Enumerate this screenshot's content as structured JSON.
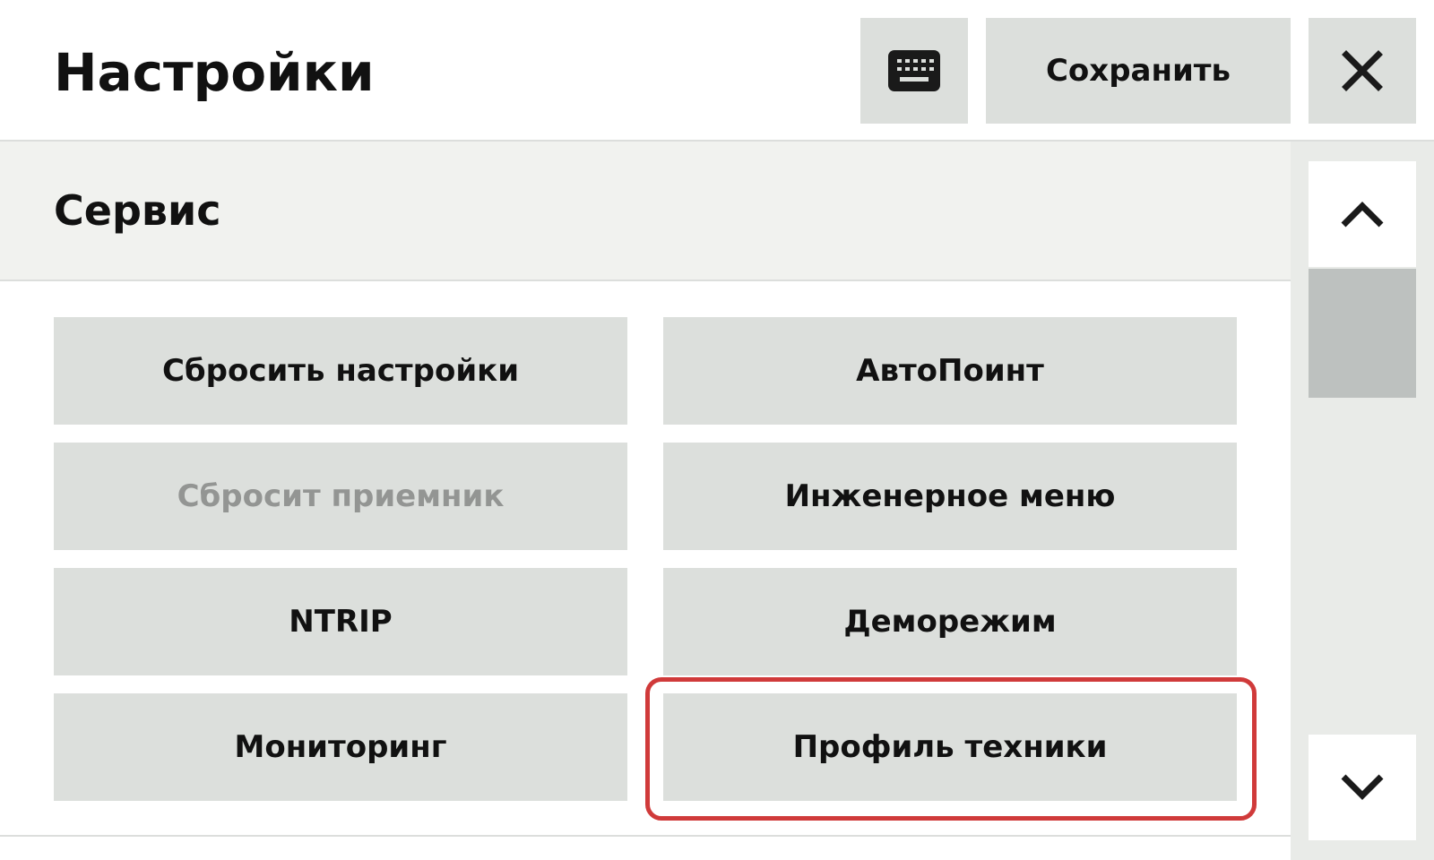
{
  "header": {
    "title": "Настройки",
    "save_label": "Сохранить"
  },
  "section": {
    "title": "Сервис"
  },
  "buttons": {
    "reset_settings": "Сбросить настройки",
    "autopoint": "АвтоПоинт",
    "reset_receiver": "Сбросит приемник",
    "engineering_menu": "Инженерное меню",
    "ntrip": "NTRIP",
    "demo_mode": "Деморежим",
    "monitoring": "Мониторинг",
    "machine_profile": "Профиль техники"
  },
  "states": {
    "reset_receiver_disabled": true,
    "highlighted_button": "machine_profile"
  },
  "colors": {
    "button_bg": "#dcdfdc",
    "disabled_text": "#939593",
    "highlight": "#d03a3a",
    "section_bg": "#f1f2ef",
    "scroll_thumb": "#bdc1bf"
  },
  "icons": {
    "keyboard": "keyboard-icon",
    "close": "close-icon",
    "scroll_up": "chevron-up-icon",
    "scroll_down": "chevron-down-icon"
  },
  "scroll": {
    "thumb_position_fraction": 0.2
  }
}
